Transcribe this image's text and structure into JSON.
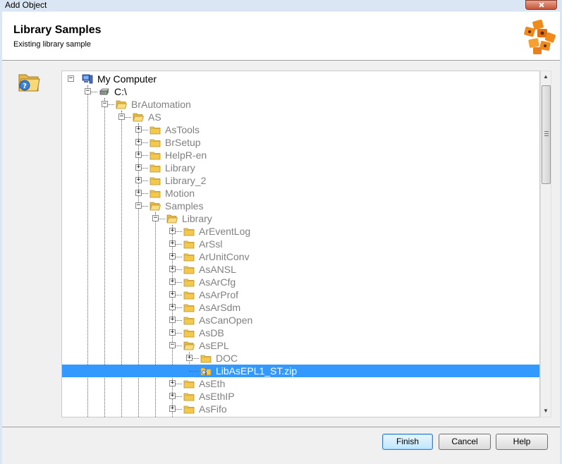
{
  "window": {
    "title": "Add Object"
  },
  "header": {
    "title": "Library Samples",
    "subtitle": "Existing library sample"
  },
  "tree": {
    "nodes": [
      {
        "label": "My Computer",
        "level": 0,
        "expander": "minus",
        "icon": "computer-icon",
        "top": true
      },
      {
        "label": "C:\\",
        "level": 1,
        "expander": "minus",
        "icon": "drive-icon",
        "top": true
      },
      {
        "label": "BrAutomation",
        "level": 2,
        "expander": "minus",
        "icon": "folder-open-icon"
      },
      {
        "label": "AS",
        "level": 3,
        "expander": "minus",
        "icon": "folder-open-icon"
      },
      {
        "label": "AsTools",
        "level": 4,
        "expander": "plus",
        "icon": "folder-icon"
      },
      {
        "label": "BrSetup",
        "level": 4,
        "expander": "plus",
        "icon": "folder-icon"
      },
      {
        "label": "HelpR-en",
        "level": 4,
        "expander": "plus",
        "icon": "folder-icon"
      },
      {
        "label": "Library",
        "level": 4,
        "expander": "plus",
        "icon": "folder-icon"
      },
      {
        "label": "Library_2",
        "level": 4,
        "expander": "plus",
        "icon": "folder-icon"
      },
      {
        "label": "Motion",
        "level": 4,
        "expander": "plus",
        "icon": "folder-icon"
      },
      {
        "label": "Samples",
        "level": 4,
        "expander": "minus",
        "icon": "folder-open-icon"
      },
      {
        "label": "Library",
        "level": 5,
        "expander": "minus",
        "icon": "folder-open-icon"
      },
      {
        "label": "ArEventLog",
        "level": 6,
        "expander": "plus",
        "icon": "folder-icon"
      },
      {
        "label": "ArSsl",
        "level": 6,
        "expander": "plus",
        "icon": "folder-icon"
      },
      {
        "label": "ArUnitConv",
        "level": 6,
        "expander": "plus",
        "icon": "folder-icon"
      },
      {
        "label": "AsANSL",
        "level": 6,
        "expander": "plus",
        "icon": "folder-icon"
      },
      {
        "label": "AsArCfg",
        "level": 6,
        "expander": "plus",
        "icon": "folder-icon"
      },
      {
        "label": "AsArProf",
        "level": 6,
        "expander": "plus",
        "icon": "folder-icon"
      },
      {
        "label": "AsArSdm",
        "level": 6,
        "expander": "plus",
        "icon": "folder-icon"
      },
      {
        "label": "AsCanOpen",
        "level": 6,
        "expander": "plus",
        "icon": "folder-icon"
      },
      {
        "label": "AsDB",
        "level": 6,
        "expander": "plus",
        "icon": "folder-icon"
      },
      {
        "label": "AsEPL",
        "level": 6,
        "expander": "minus",
        "icon": "folder-open-icon"
      },
      {
        "label": "DOC",
        "level": 7,
        "expander": "plus",
        "icon": "folder-icon"
      },
      {
        "label": "LibAsEPL1_ST.zip",
        "level": 7,
        "expander": "none",
        "icon": "zip-file-icon",
        "selected": true,
        "last": true
      },
      {
        "label": "AsEth",
        "level": 6,
        "expander": "plus",
        "icon": "folder-icon"
      },
      {
        "label": "AsEthIP",
        "level": 6,
        "expander": "plus",
        "icon": "folder-icon"
      },
      {
        "label": "AsFifo",
        "level": 6,
        "expander": "plus",
        "icon": "folder-icon"
      }
    ]
  },
  "buttons": {
    "finish": "Finish",
    "cancel": "Cancel",
    "help": "Help"
  },
  "colors": {
    "selection": "#3399ff",
    "folder": "#f2c94c",
    "logo": "#f08a1a"
  }
}
